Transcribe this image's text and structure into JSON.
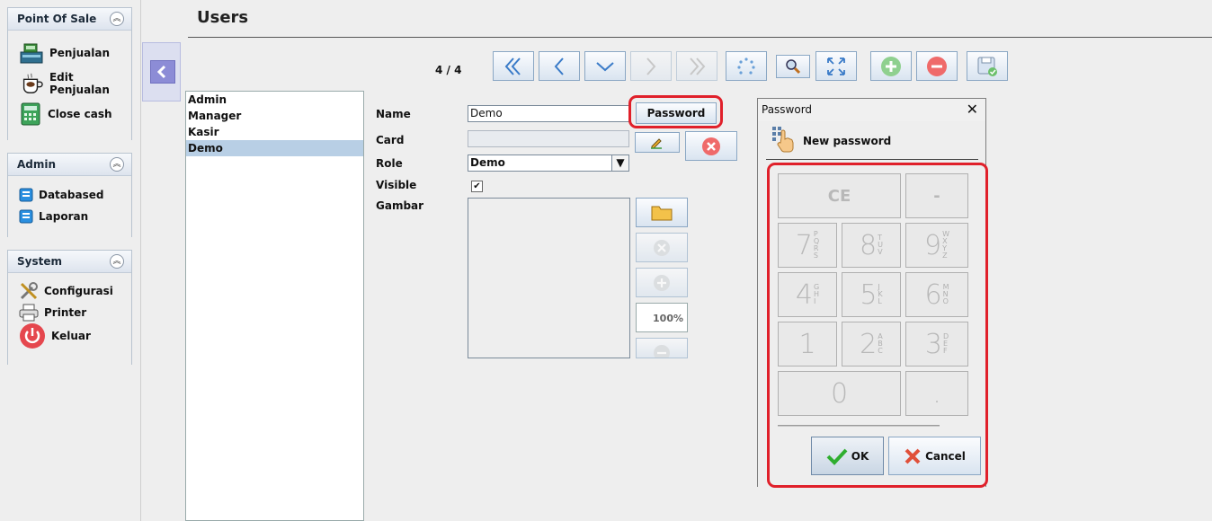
{
  "sidebar": {
    "pos": {
      "title": "Point Of Sale",
      "items": [
        {
          "label": "Penjualan",
          "icon": "cash-register-icon"
        },
        {
          "label": "Edit Penjualan",
          "icon": "coffee-icon"
        },
        {
          "label": "Close cash",
          "icon": "calculator-icon"
        }
      ]
    },
    "admin": {
      "title": "Admin",
      "items": [
        {
          "label": "Databased",
          "icon": "database-icon"
        },
        {
          "label": "Laporan",
          "icon": "report-icon"
        }
      ]
    },
    "system": {
      "title": "System",
      "items": [
        {
          "label": "Configurasi",
          "icon": "tools-icon"
        },
        {
          "label": "Printer",
          "icon": "printer-icon"
        },
        {
          "label": "Keluar",
          "icon": "power-icon"
        }
      ]
    }
  },
  "page": {
    "title": "Users",
    "counter": "4 / 4"
  },
  "users": [
    "Admin",
    "Manager",
    "Kasir",
    "Demo"
  ],
  "selected_user": "Demo",
  "form": {
    "name_label": "Name",
    "name_value": "Demo",
    "password_button": "Password",
    "card_label": "Card",
    "card_value": "",
    "role_label": "Role",
    "role_value": "Demo",
    "visible_label": "Visible",
    "visible_checked": true,
    "image_label": "Gambar",
    "zoom_value": "100%"
  },
  "dialog": {
    "title": "Password",
    "header": "New password",
    "keys": {
      "ce": "CE",
      "minus": "-",
      "k7": "7",
      "k7s": [
        "P",
        "Q",
        "R",
        "S"
      ],
      "k8": "8",
      "k8s": [
        "T",
        "U",
        "V"
      ],
      "k9": "9",
      "k9s": [
        "W",
        "X",
        "Y",
        "Z"
      ],
      "k4": "4",
      "k4s": [
        "G",
        "H",
        "I"
      ],
      "k5": "5",
      "k5s": [
        "J",
        "K",
        "L"
      ],
      "k6": "6",
      "k6s": [
        "M",
        "N",
        "O"
      ],
      "k1": "1",
      "k2": "2",
      "k2s": [
        "A",
        "B",
        "C"
      ],
      "k3": "3",
      "k3s": [
        "D",
        "E",
        "F"
      ],
      "k0": "0",
      "dot": "."
    },
    "ok_label": "OK",
    "cancel_label": "Cancel"
  }
}
